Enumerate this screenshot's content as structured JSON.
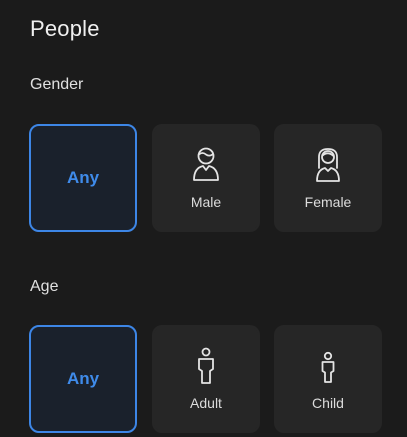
{
  "panel": {
    "title": "People"
  },
  "gender": {
    "label": "Gender",
    "options": [
      {
        "label": "Any",
        "selected": true,
        "icon": ""
      },
      {
        "label": "Male",
        "selected": false,
        "icon": "male-person-icon"
      },
      {
        "label": "Female",
        "selected": false,
        "icon": "female-person-icon"
      }
    ]
  },
  "age": {
    "label": "Age",
    "options": [
      {
        "label": "Any",
        "selected": true,
        "icon": ""
      },
      {
        "label": "Adult",
        "selected": false,
        "icon": "adult-person-icon"
      },
      {
        "label": "Child",
        "selected": false,
        "icon": "child-person-icon"
      }
    ]
  },
  "colors": {
    "background": "#1b1b1b",
    "tile": "#262626",
    "selected_tile": "#1a212c",
    "accent": "#3d86e6",
    "text": "#e6e6e6"
  }
}
